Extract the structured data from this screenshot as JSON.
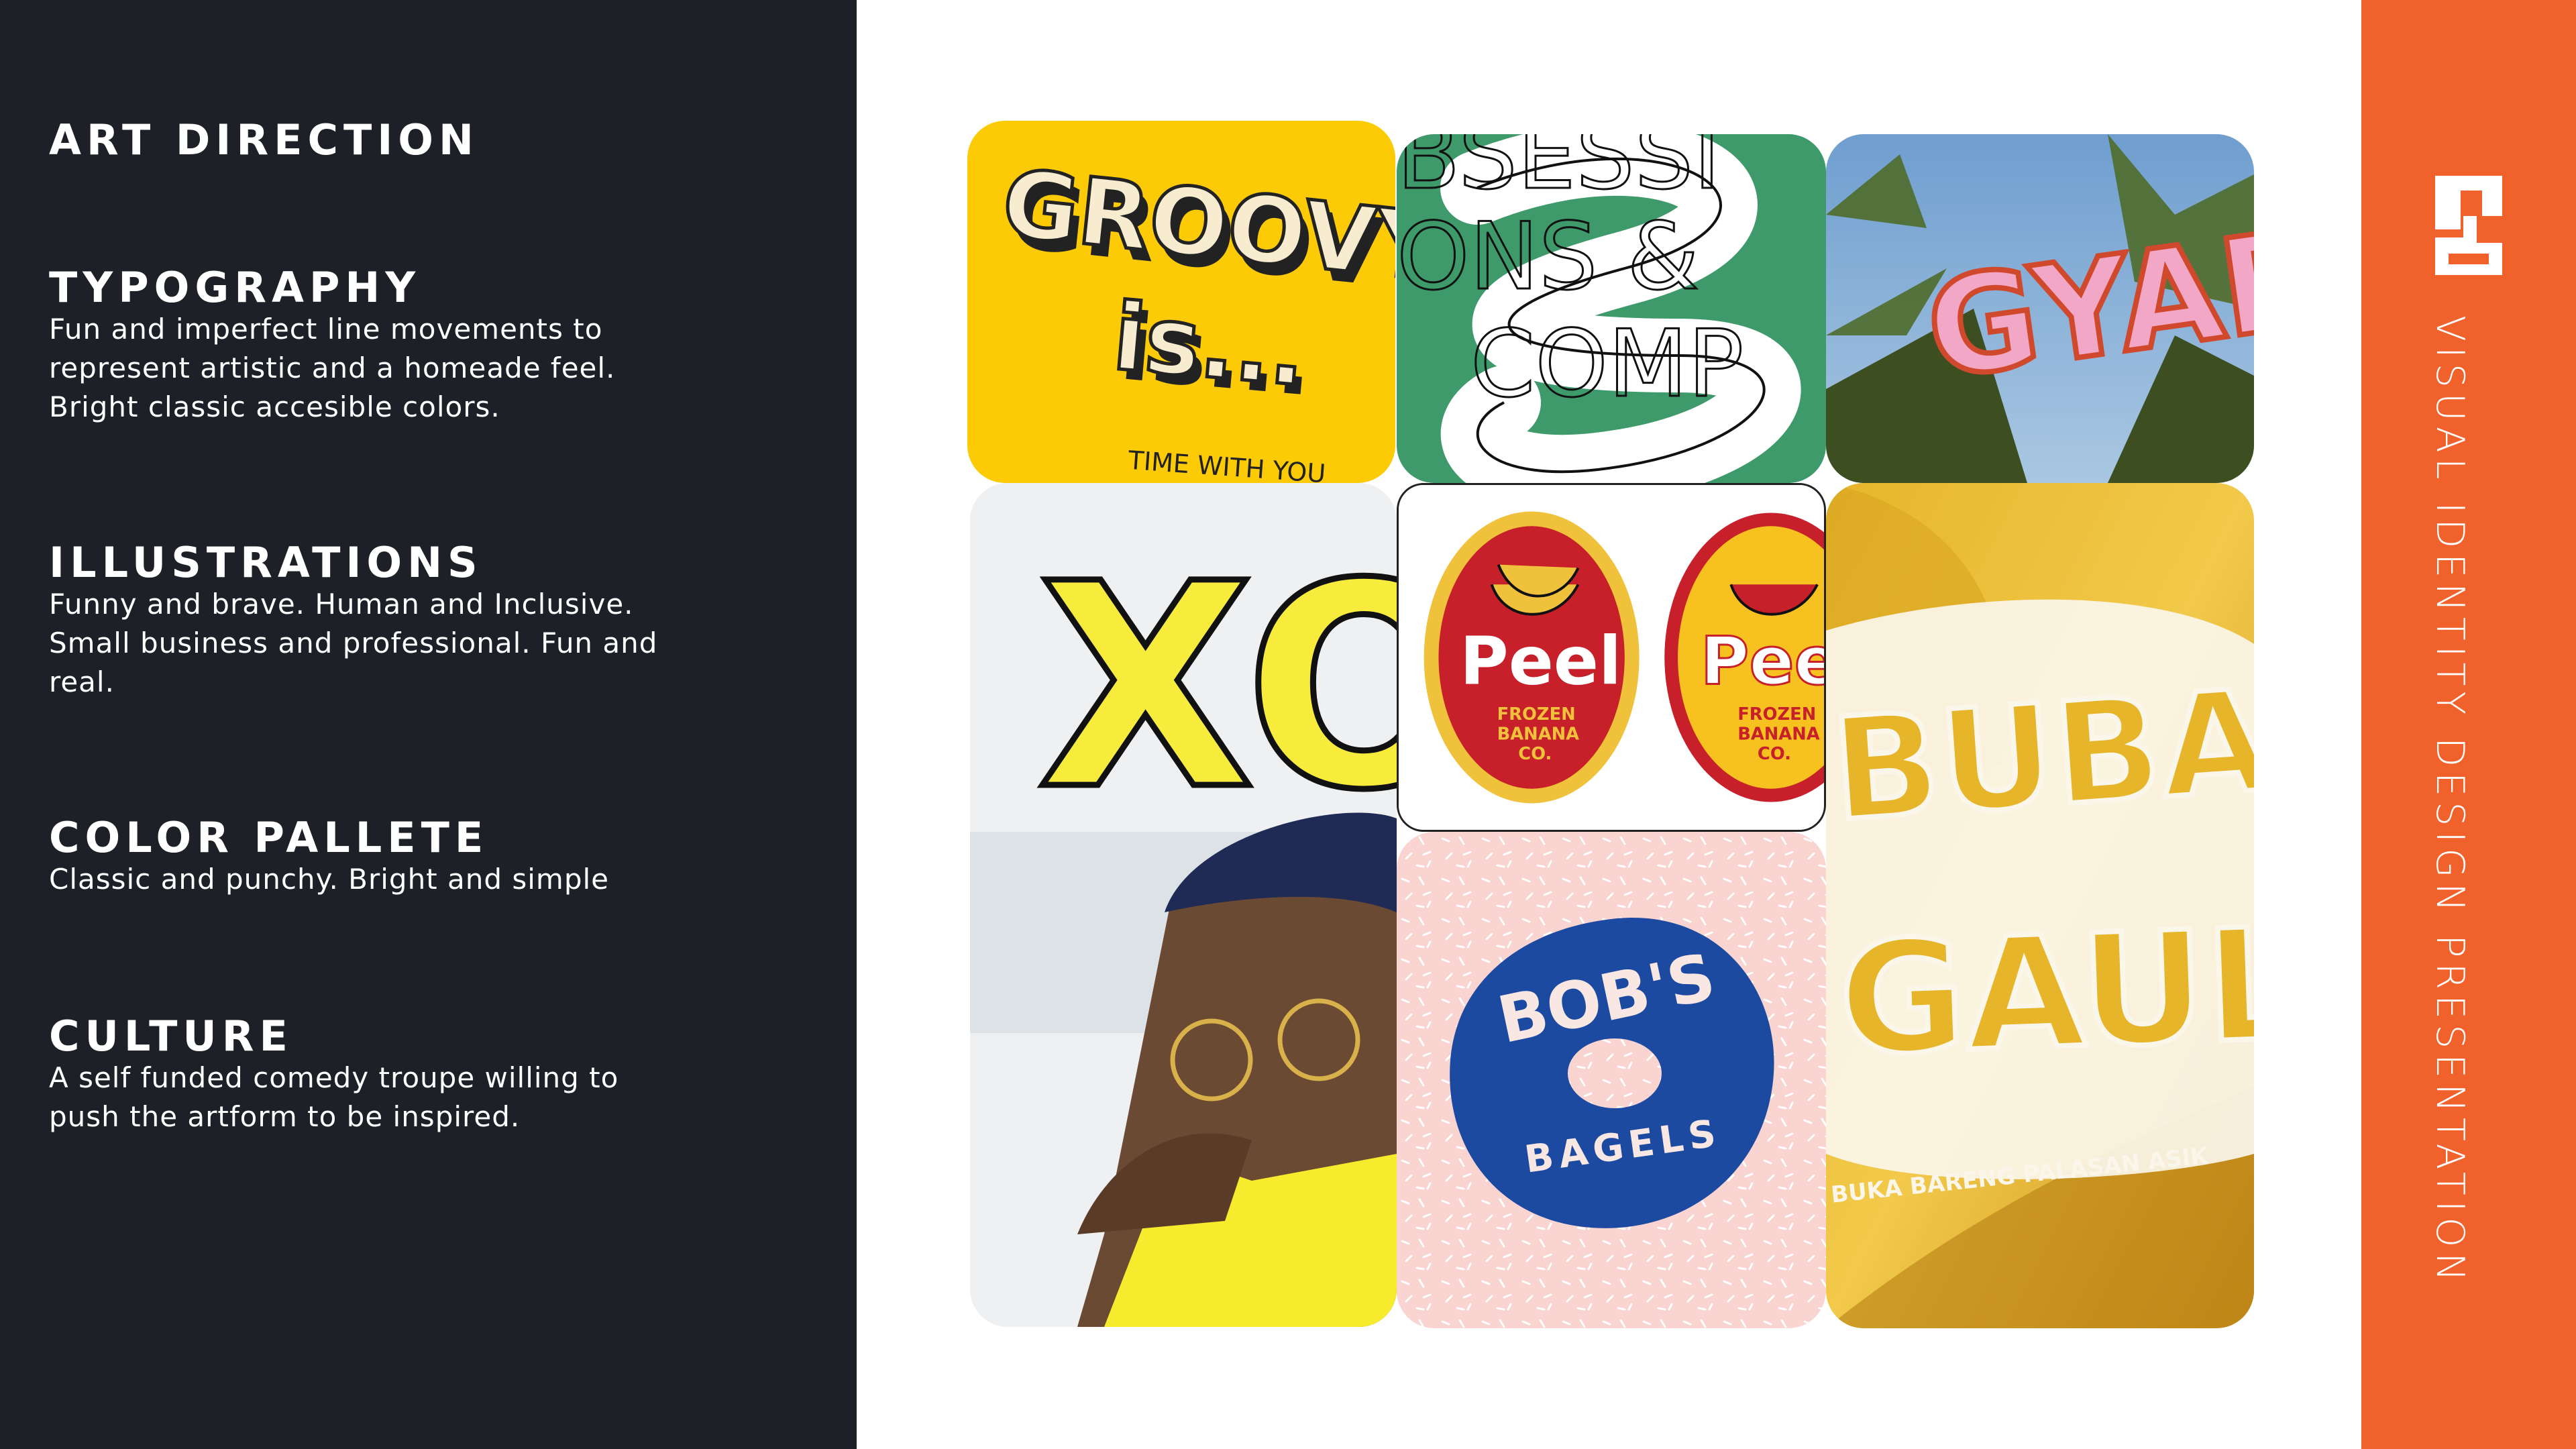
{
  "left": {
    "title": "ART DIRECTION",
    "sections": [
      {
        "heading": "TYPOGRAPHY",
        "body": "Fun and imperfect line movements to represent artistic and a homeade feel. Bright classic accesible colors."
      },
      {
        "heading": "ILLUSTRATIONS",
        "body": "Funny and brave. Human and Inclusive. Small business and professional. Fun and real."
      },
      {
        "heading": "COLOR PALLETE",
        "body": "Classic and punchy. Bright and simple"
      },
      {
        "heading": "CULTURE",
        "body": "A self funded comedy troupe willing to push the artform to be inspired."
      }
    ]
  },
  "sidebar": {
    "vertical_title": "VISUAL IDENTITY DESIGN PRESENTATION",
    "logo_icon": "nb-monogram-icon"
  },
  "tiles": {
    "groovy": {
      "line1": "GROOVY",
      "line2": "is...",
      "caption": "TIME WITH YOU"
    },
    "obsessions": {
      "line1": "BSESSI",
      "line2": "ONS &",
      "line3": "COMP"
    },
    "graffiti": {
      "text": "GYAF"
    },
    "xo": {
      "text": "XO"
    },
    "peel": {
      "brand": "Peel",
      "sub1": "FROZEN",
      "sub2": "BANANA",
      "sub3": "CO."
    },
    "bobs": {
      "top": "BOB'S",
      "bottom": "BAGELS"
    },
    "banana": {
      "line1": "BUBAH",
      "line2": "GAUL",
      "caption": "BUKA BARENG PALASAN ASIK"
    }
  },
  "colors": {
    "left_bg": "#1d2127",
    "accent": "#f1612b",
    "yellow": "#fccb06",
    "green": "#3e9a6b",
    "red": "#c8202a",
    "blue": "#1c4aa0",
    "pink": "#f9d4d1"
  }
}
